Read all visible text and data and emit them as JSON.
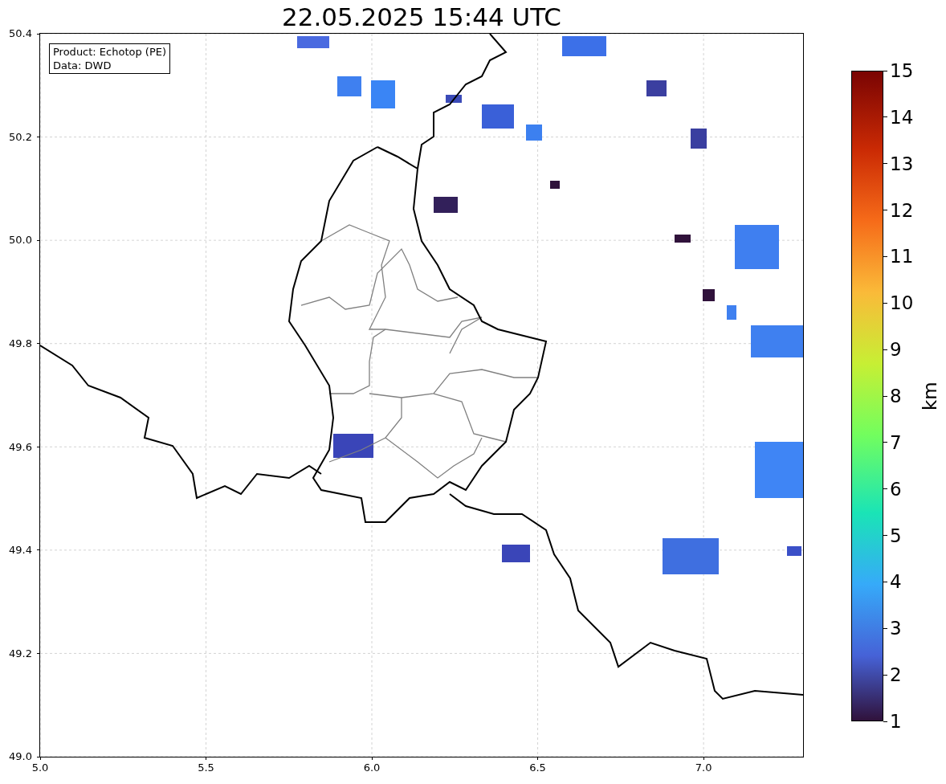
{
  "title": "22.05.2025 15:44 UTC",
  "legend": {
    "lines": [
      "Product: Echotop (PE)",
      "Data: DWD"
    ]
  },
  "x_axis": {
    "ticks": [
      "5.0",
      "5.5",
      "6.0",
      "6.5",
      "7.0"
    ]
  },
  "y_axis": {
    "ticks": [
      "50.4",
      "50.2",
      "50.0",
      "49.8",
      "49.6",
      "49.4",
      "49.2",
      "49.0"
    ]
  },
  "colorbar": {
    "label": "km",
    "ticks": [
      "15",
      "14",
      "13",
      "12",
      "11",
      "10",
      "9",
      "8",
      "7",
      "6",
      "5",
      "4",
      "3",
      "2",
      "1"
    ]
  }
}
